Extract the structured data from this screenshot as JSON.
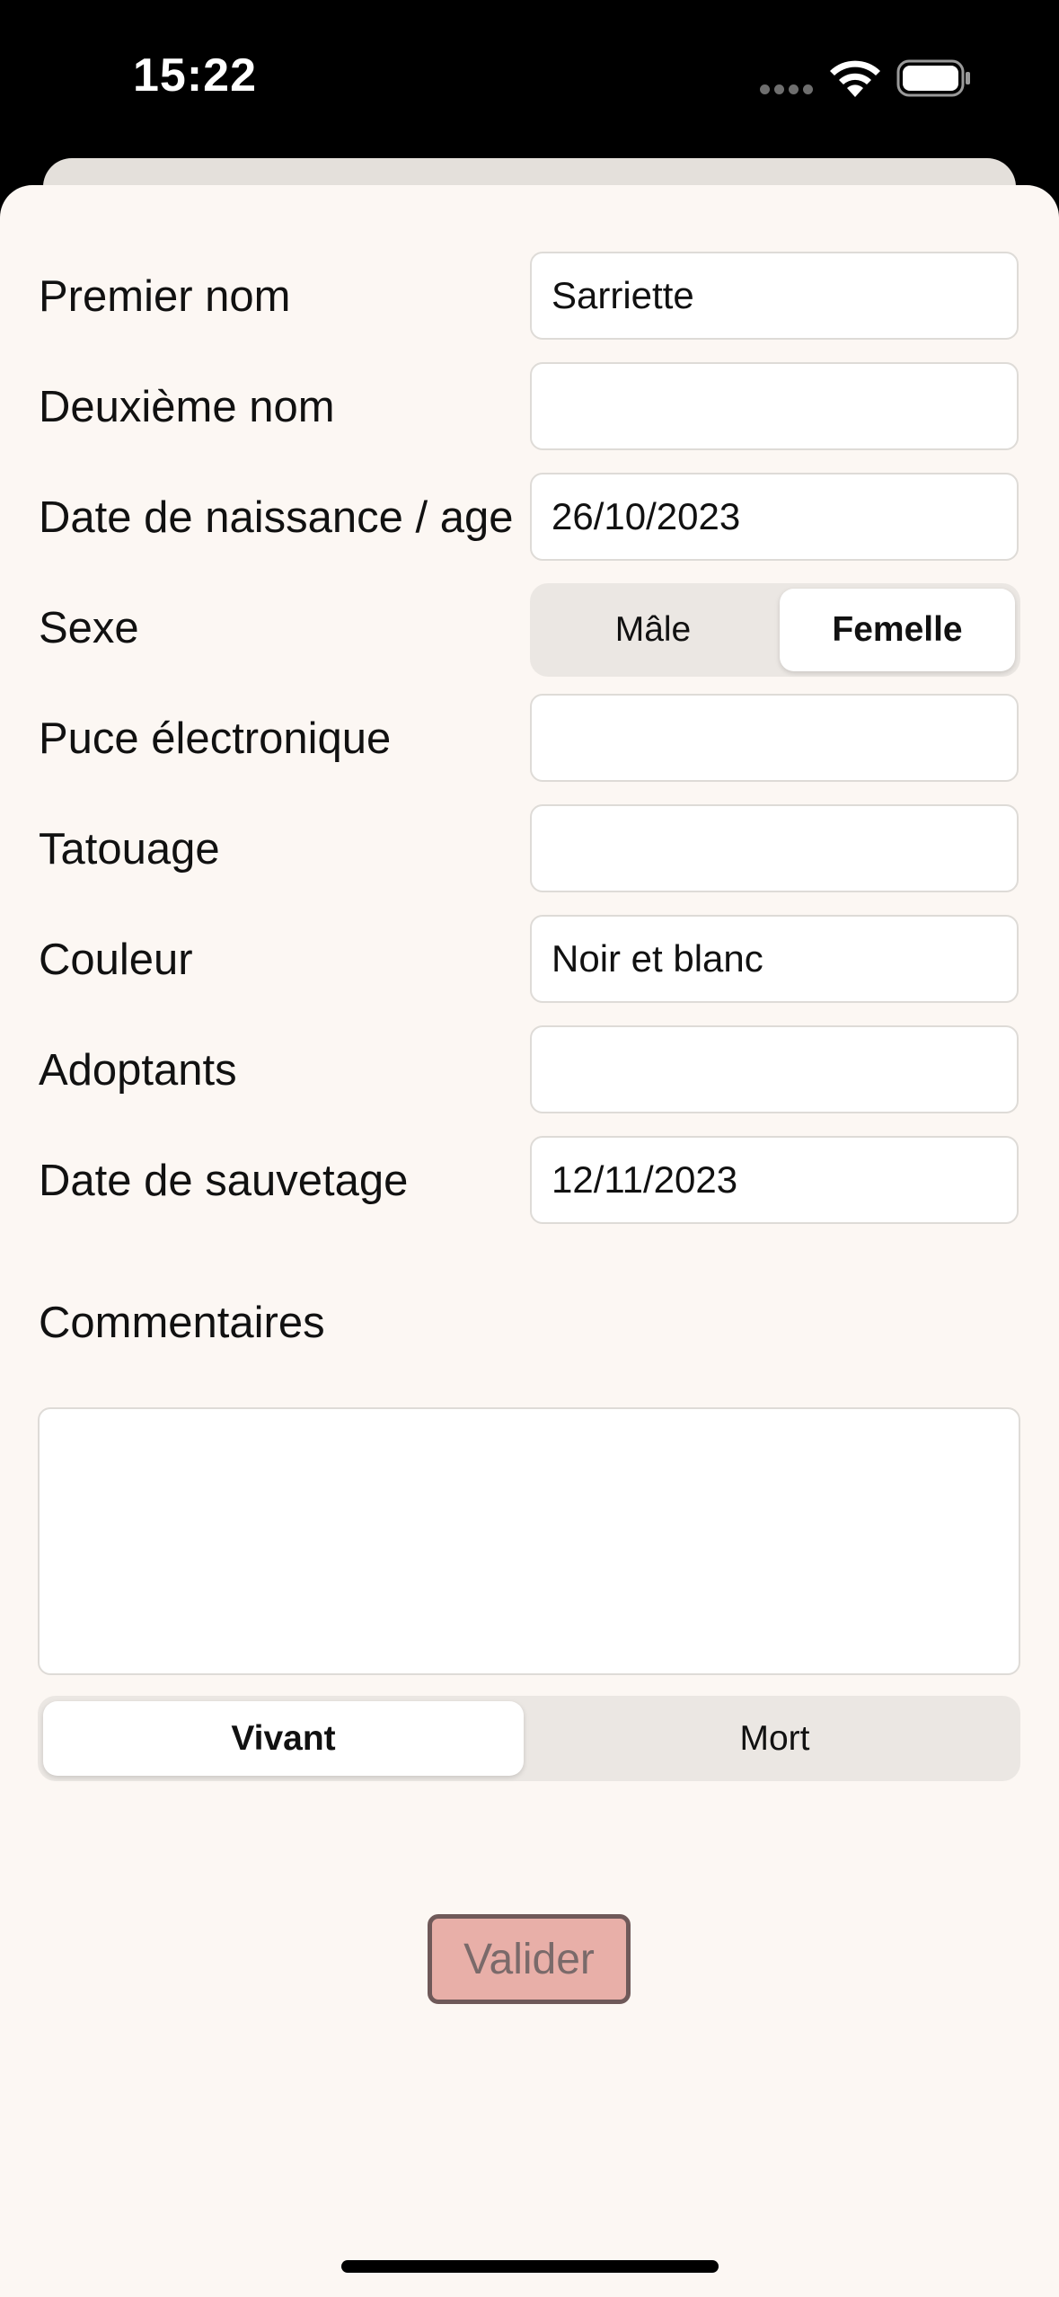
{
  "status_bar": {
    "time": "15:22"
  },
  "form": {
    "fields": [
      {
        "label": "Premier nom",
        "value": "Sarriette"
      },
      {
        "label": "Deuxième nom",
        "value": ""
      },
      {
        "label": "Date de naissance / age",
        "value": "26/10/2023"
      },
      {
        "label": "Puce électronique",
        "value": ""
      },
      {
        "label": "Tatouage",
        "value": ""
      },
      {
        "label": "Couleur",
        "value": "Noir et blanc"
      },
      {
        "label": "Adoptants",
        "value": ""
      },
      {
        "label": "Date de sauvetage",
        "value": "12/11/2023"
      }
    ],
    "sex": {
      "label": "Sexe",
      "options": [
        "Mâle",
        "Femelle"
      ],
      "selected": "Femelle"
    },
    "comments": {
      "label": "Commentaires",
      "value": ""
    },
    "status": {
      "options": [
        "Vivant",
        "Mort"
      ],
      "selected": "Vivant"
    },
    "submit_label": "Valider"
  },
  "colors": {
    "sheet_background": "#fcf7f3",
    "button_fill": "#e8afa8",
    "button_border": "#6f5959"
  }
}
